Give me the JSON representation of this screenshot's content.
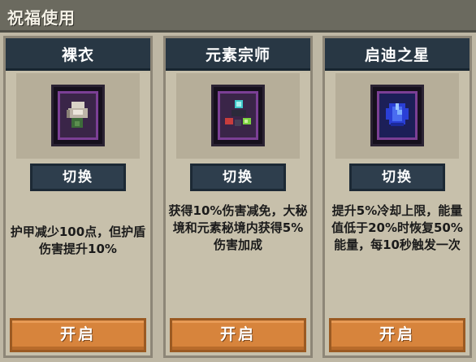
{
  "header": {
    "title": "祝福使用"
  },
  "cards": [
    {
      "name": "裸衣",
      "switch_label": "切换",
      "description": "护甲减少100点，但护盾伤害提升10%",
      "open_label": "开启",
      "icon": "armor-figure-icon"
    },
    {
      "name": "元素宗师",
      "switch_label": "切换",
      "description": "获得10%伤害减免，大秘境和元素秘境内获得5%伤害加成",
      "open_label": "开启",
      "icon": "elemental-orbs-icon"
    },
    {
      "name": "启迪之星",
      "switch_label": "切换",
      "description": "提升5%冷却上限，能量值低于20%时恢复50%能量，每10秒触发一次",
      "open_label": "开启",
      "icon": "blue-star-crystal-icon"
    }
  ],
  "colors": {
    "header_bg": "#283744",
    "button_orange": "#d7843c",
    "icon_border": "#7b3f95"
  }
}
